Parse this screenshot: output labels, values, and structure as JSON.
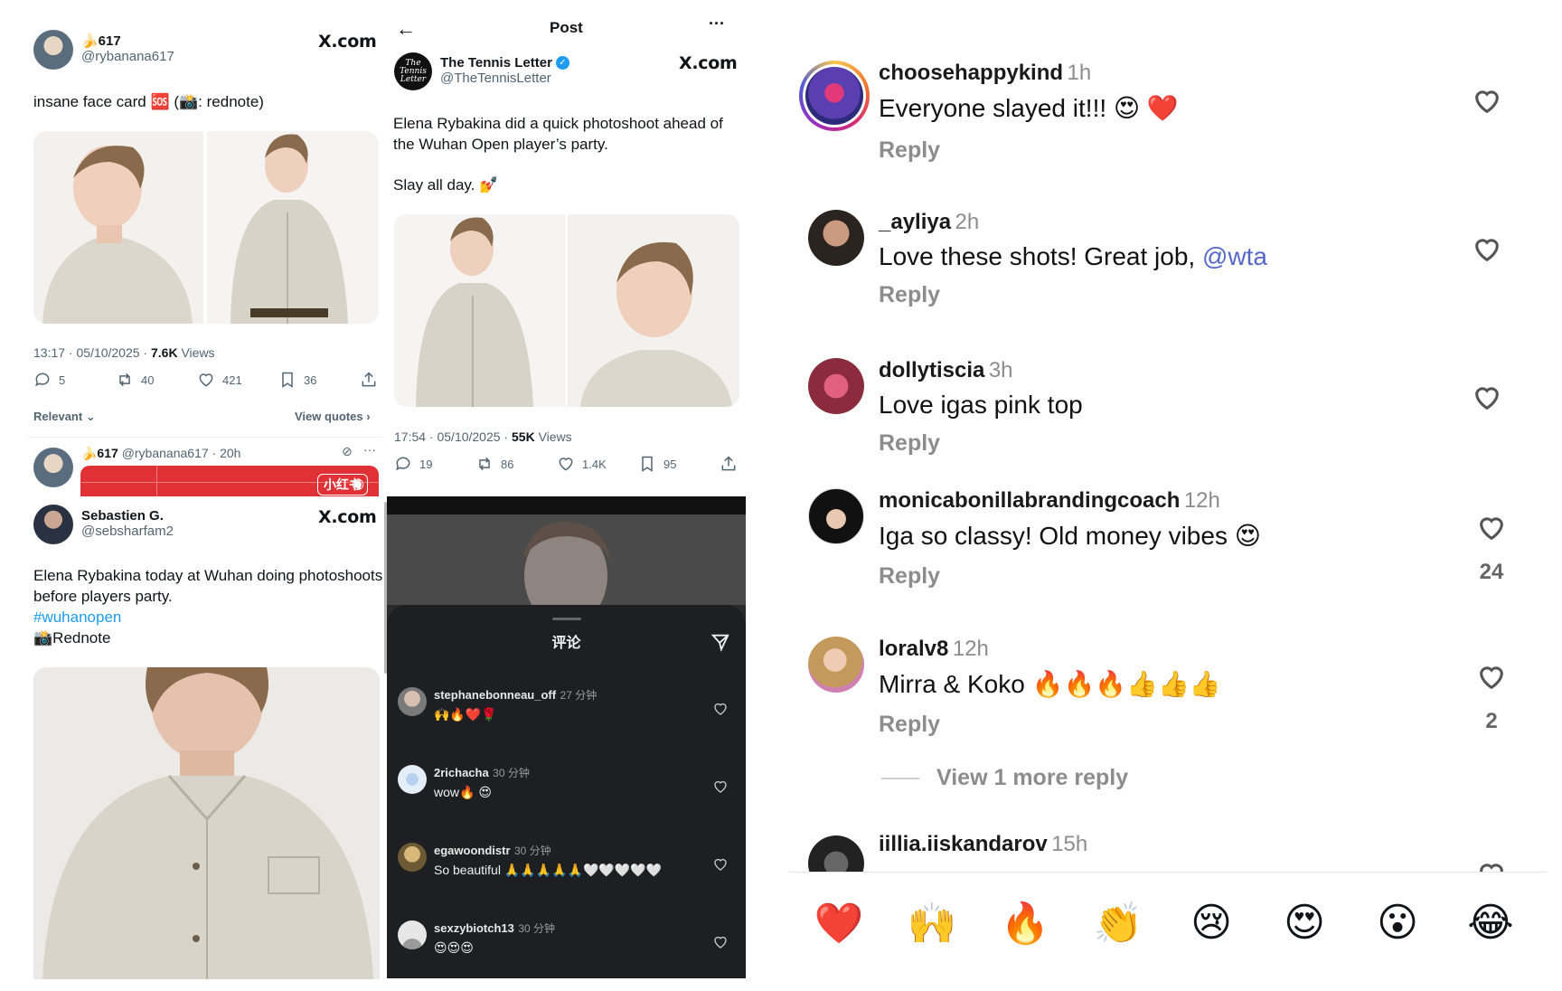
{
  "post1": {
    "display_name": "🍌617",
    "handle": "@rybanana617",
    "brand": "X.com",
    "text": "insane face card 🆘 (📸: rednote)",
    "timestamp": "13:17 · 05/10/2025 · ",
    "views_count": "7.6K",
    "views_label": " Views",
    "replies": "5",
    "reposts": "40",
    "likes": "421",
    "bookmarks": "36",
    "sort_label": "Relevant",
    "view_quotes": "View quotes",
    "reply_preview": {
      "display_name": "🍌617",
      "handle_time": "@rybanana617 · 20h",
      "badge_text": "小红书"
    }
  },
  "post2": {
    "display_name": "Sebastien G.",
    "handle": "@sebsharfam2",
    "brand": "X.com",
    "text_line1": "Elena Rybakina today at Wuhan doing photoshoots",
    "text_line2": "before players party.",
    "hashtag": "#wuhanopen",
    "source": "📸Rednote"
  },
  "post3": {
    "header_title": "Post",
    "display_name": "The Tennis Letter",
    "handle": "@TheTennisLetter",
    "brand": "X.com",
    "text_line1": "Elena Rybakina did a quick photoshoot ahead of",
    "text_line2": "the Wuhan Open player’s party.",
    "text_line3": "Slay all day. 💅",
    "timestamp": "17:54 · 05/10/2025 · ",
    "views_count": "55K",
    "views_label": " Views",
    "replies": "19",
    "reposts": "86",
    "likes": "1.4K",
    "bookmarks": "95"
  },
  "rednote_comments": {
    "sheet_title": "评论",
    "items": [
      {
        "user": "stephanebonneau_off",
        "time": "27 分钟",
        "text": "🙌🔥❤️🌹"
      },
      {
        "user": "2richacha",
        "time": "30 分钟",
        "text": "wow🔥 😍"
      },
      {
        "user": "egawoondistr",
        "time": "30 分钟",
        "text": "So beautiful 🙏🙏🙏🙏🙏🤍🤍🤍🤍🤍"
      },
      {
        "user": "sexzybiotch13",
        "time": "30 分钟",
        "text": "😍😍😍"
      }
    ]
  },
  "instagram_comments": {
    "items": [
      {
        "user": "choosehappykind",
        "time": "1h",
        "text": "Everyone slayed it!!! 😍 ❤️",
        "reply": "Reply",
        "likes": ""
      },
      {
        "user": "_ayliya",
        "time": "2h",
        "text": "Love these shots! Great job, ",
        "mention": "@wta",
        "reply": "Reply",
        "likes": ""
      },
      {
        "user": "dollytiscia",
        "time": "3h",
        "text": "Love igas pink top",
        "reply": "Reply",
        "likes": ""
      },
      {
        "user": "monicabonillabrandingcoach",
        "time": "12h",
        "text": "Iga so classy! Old money vibes 😍",
        "reply": "Reply",
        "likes": "24"
      },
      {
        "user": "loralv8",
        "time": "12h",
        "text": "Mirra & Koko 🔥🔥🔥👍👍👍",
        "reply": "Reply",
        "likes": "2"
      },
      {
        "user": "iillia.iiskandarov",
        "time": "15h",
        "text": "",
        "reply": "",
        "likes": ""
      }
    ],
    "view_more": "View 1 more reply",
    "emoji_bar": [
      "❤️",
      "🙌",
      "🔥",
      "👏",
      "😢",
      "😍",
      "😮",
      "😂"
    ]
  },
  "colors": {
    "link_blue": "#1d9bf0",
    "verified_blue": "#1d9bf0",
    "rednote_red": "#e03137",
    "dark_sheet": "#1e1f22"
  }
}
